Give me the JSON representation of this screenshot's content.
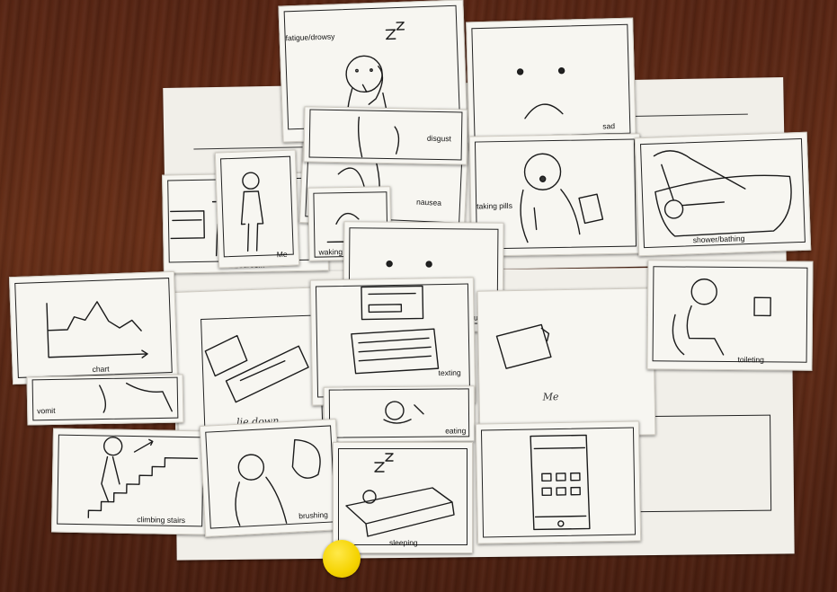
{
  "cards": {
    "fatigue": "fatigue/drowsy",
    "disgust": "disgust",
    "sad": "sad",
    "nausea": "nausea",
    "taking_pills": "taking pills",
    "shower": "shower/bathing",
    "me": "Me",
    "bedroom": "bedroom",
    "waking": "waking",
    "neutral": "neutral",
    "chart": "chart",
    "vomit": "vomit",
    "texting": "texting",
    "eating": "eating",
    "toileting": "toileting",
    "climbing": "climbing stairs",
    "brushing": "brushing",
    "sleeping": "sleeping"
  },
  "handwriting": {
    "lie_down": "lie down",
    "me_note": "Me"
  },
  "colors": {
    "table": "#5a2614",
    "paper": "#f7f6f1",
    "marker": "#f5d300"
  }
}
